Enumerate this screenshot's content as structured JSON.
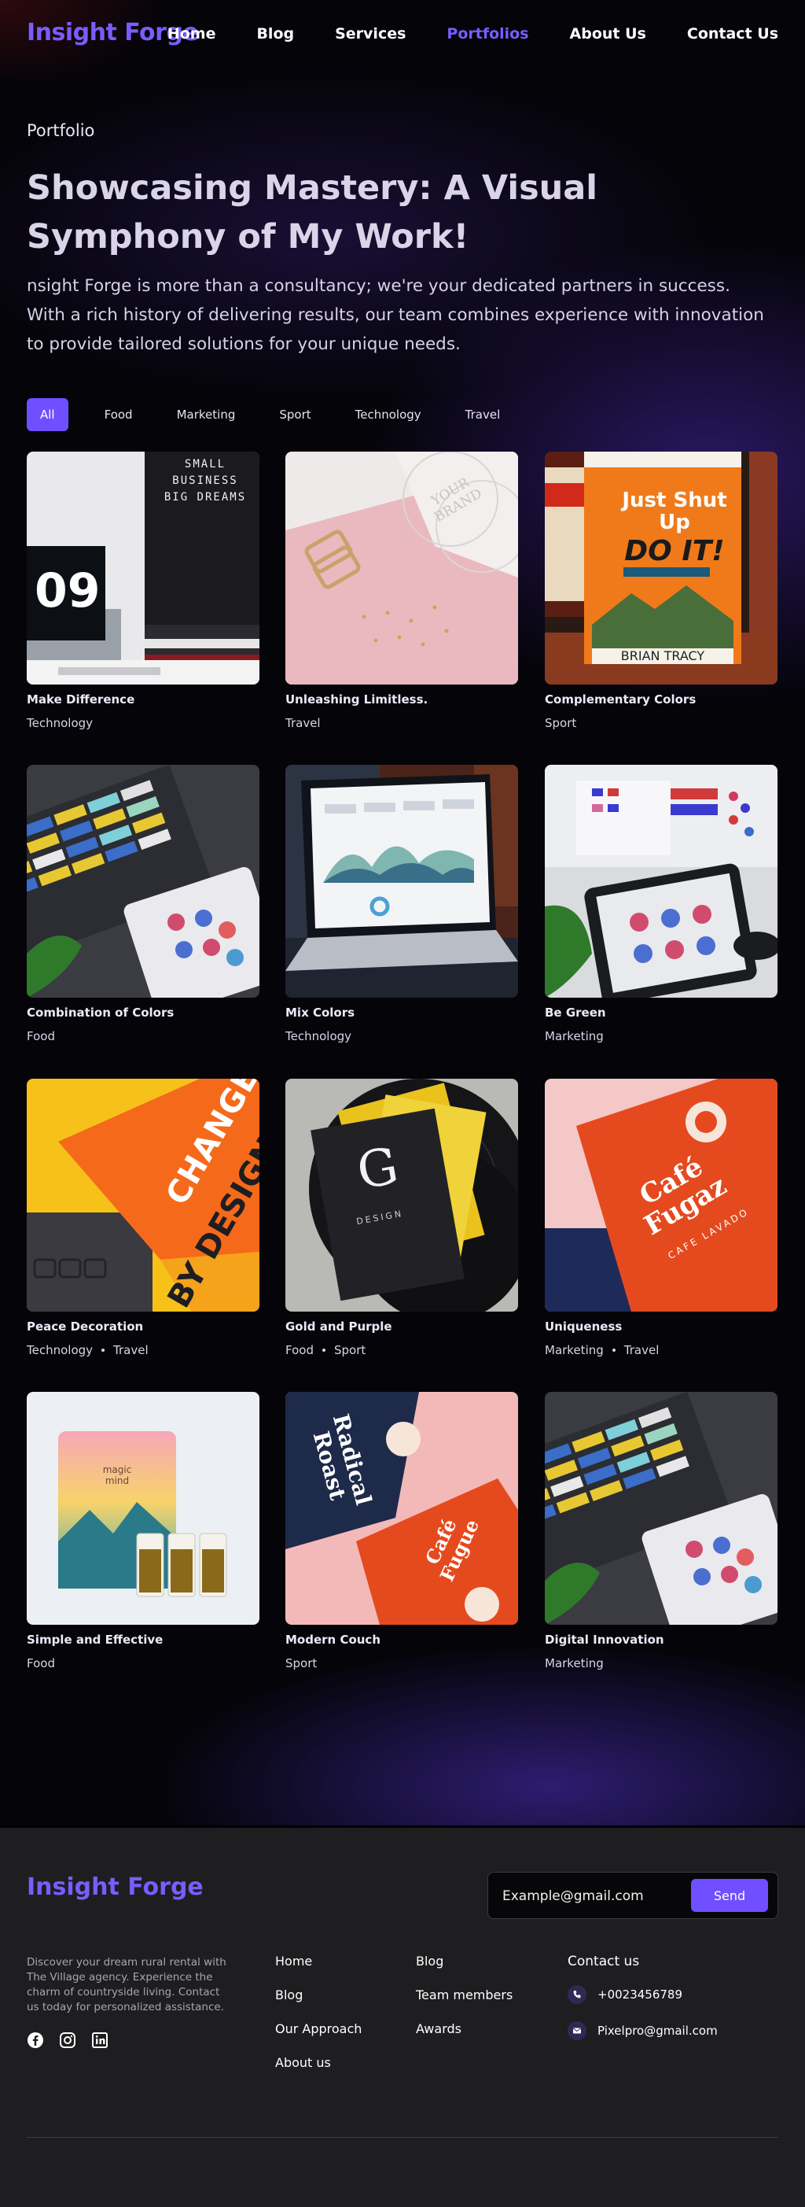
{
  "brand": {
    "name": "Insight Forge",
    "accent": "#6f4fff"
  },
  "nav": {
    "items": [
      {
        "label": "Home"
      },
      {
        "label": "Blog"
      },
      {
        "label": "Services"
      },
      {
        "label": "Portfolios",
        "active": true
      },
      {
        "label": "About Us"
      },
      {
        "label": "Contact Us"
      }
    ]
  },
  "hero": {
    "eyebrow": "Portfolio",
    "title": "Showcasing Mastery: A Visual Symphony of My Work!",
    "description": "nsight Forge is more than a consultancy; we're your dedicated partners in success. With a rich history of delivering results, our team combines experience with innovation to provide tailored solutions for your unique needs."
  },
  "filters": [
    "All",
    "Food",
    "Marketing",
    "Sport",
    "Technology",
    "Travel"
  ],
  "portfolio": [
    {
      "title": "Make Difference",
      "tags": [
        "Technology"
      ]
    },
    {
      "title": "Unleashing Limitless.",
      "tags": [
        "Travel"
      ]
    },
    {
      "title": "Complementary Colors",
      "tags": [
        "Sport"
      ]
    },
    {
      "title": "Combination of Colors",
      "tags": [
        "Food"
      ]
    },
    {
      "title": "Mix Colors",
      "tags": [
        "Technology"
      ]
    },
    {
      "title": "Be Green",
      "tags": [
        "Marketing"
      ]
    },
    {
      "title": "Peace Decoration",
      "tags": [
        "Technology",
        "Travel"
      ]
    },
    {
      "title": "Gold and Purple",
      "tags": [
        "Food",
        "Sport"
      ]
    },
    {
      "title": "Uniqueness",
      "tags": [
        "Marketing",
        "Travel"
      ]
    },
    {
      "title": "Simple and Effective",
      "tags": [
        "Food"
      ]
    },
    {
      "title": "Modern Couch",
      "tags": [
        "Sport"
      ]
    },
    {
      "title": "Digital Innovation",
      "tags": [
        "Marketing"
      ]
    }
  ],
  "thumb_text": {
    "p1_board": "SMALL BUSINESS BIG DREAMS",
    "p1_number": "09",
    "p2_card": "YOUR BRAND",
    "p3_book_top": "Just Shut Up",
    "p3_book_main": "DO IT!",
    "p3_author": "BRIAN TRACY",
    "p7_change": "CHANGE",
    "p7_by_design": "BY DESIGN",
    "p8_letter": "G",
    "p8_small": "DESIGN",
    "p9_brand": "Café Fugaz",
    "p9_sub": "CAFE LAVADO",
    "p10_label": "magic mind",
    "p11_top": "Radical Roast",
    "p11_bottom": "Café Fugue"
  },
  "footer": {
    "brand": "Insight Forge",
    "email_placeholder": "Example@gmail.com",
    "send_label": "Send",
    "about": "Discover your dream rural rental with The Village agency. Experience the charm of countryside living. Contact us today for personalized assistance.",
    "socials": [
      "facebook-icon",
      "instagram-icon",
      "linkedin-icon"
    ],
    "col1": [
      "Home",
      "Blog",
      "Our Approach",
      "About us"
    ],
    "col2": [
      "Blog",
      "Team members",
      "Awards"
    ],
    "contact_heading": "Contact us",
    "phone": "+0023456789",
    "email": "Pixelpro@gmail.com"
  }
}
